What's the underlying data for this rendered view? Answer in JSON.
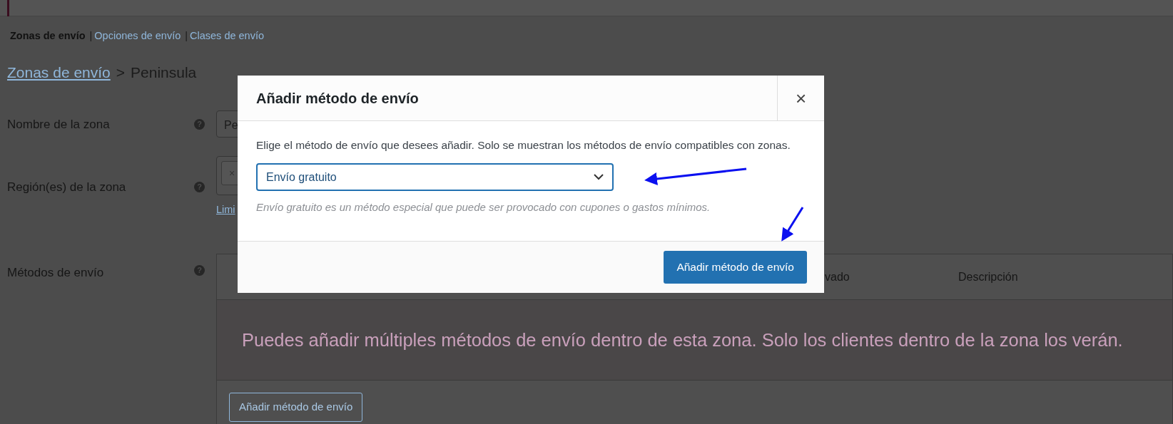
{
  "subnav": [
    {
      "label": "Zonas de envío",
      "selected": true
    },
    {
      "label": "Opciones de envío",
      "selected": false,
      "separator": "|"
    },
    {
      "label": "Clases de envío",
      "selected": false,
      "separator": "|"
    }
  ],
  "breadcrumb": {
    "link": "Zonas de envío",
    "divider": ">",
    "current": "Peninsula"
  },
  "fields": [
    {
      "label": "Nombre de la zona",
      "hint": "?",
      "kind": "text",
      "value": "Pe"
    },
    {
      "label": "Región(es) de la zona",
      "hint": "?",
      "kind": "regions",
      "chip": "×",
      "link": "Limi"
    }
  ],
  "methods": {
    "label": "Métodos de envío",
    "hint": "?",
    "columns": [
      "vado",
      "Descripción"
    ],
    "empty_message": "Puedes añadir múltiples métodos de envío dentro de esta zona. Solo los clientes dentro de la zona los verán.",
    "button": "Añadir método de envío"
  },
  "modal": {
    "title": "Añadir método de envío",
    "close": "×",
    "intro": "Elige el método de envío que desees añadir. Solo se muestran los métodos de envío compatibles con zonas.",
    "select": {
      "value": "Envío gratuito"
    },
    "help": "Envío gratuito es un método especial que puede ser provocado con cupones o gastos mínimos.",
    "button": "Añadir método de envío"
  }
}
